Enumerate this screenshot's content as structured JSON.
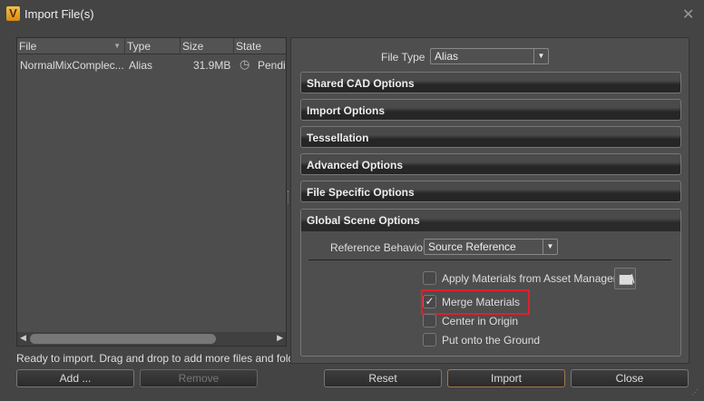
{
  "window": {
    "title": "Import File(s)",
    "logo": "V",
    "close": "✕"
  },
  "table": {
    "headers": [
      "File",
      "Type",
      "Size",
      "State"
    ],
    "rows": [
      {
        "file": "NormalMixComplec...",
        "type": "Alias",
        "size": "31.9MB",
        "state": "Pendi"
      }
    ]
  },
  "status": "Ready to import. Drag and drop to add more files and folders.",
  "buttons": {
    "add": "Add ...",
    "remove": "Remove",
    "reset": "Reset",
    "import": "Import",
    "close": "Close"
  },
  "file_type": {
    "label": "File Type",
    "value": "Alias"
  },
  "sections": [
    "Shared CAD Options",
    "Import Options",
    "Tessellation",
    "Advanced Options",
    "File Specific Options"
  ],
  "global": {
    "title": "Global Scene Options",
    "ref_label": "Reference Behavior",
    "ref_value": "Source Reference",
    "options": [
      {
        "label": "Apply Materials from Asset Manager",
        "checked": false
      },
      {
        "label": "Merge Materials",
        "checked": true
      },
      {
        "label": "Center in Origin",
        "checked": false
      },
      {
        "label": "Put onto the Ground",
        "checked": false
      }
    ]
  }
}
